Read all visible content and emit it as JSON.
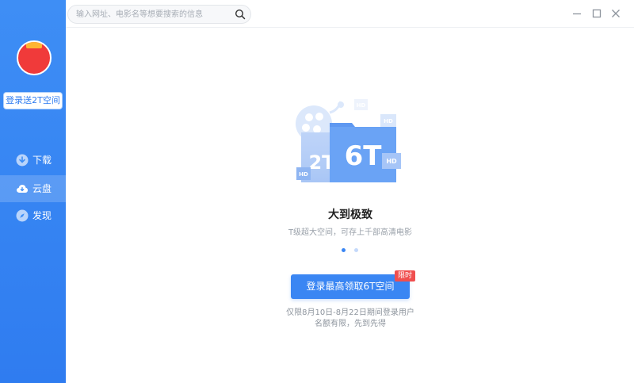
{
  "sidebar": {
    "login_label": "登录送2T空间",
    "items": [
      {
        "label": "下载",
        "icon": "download-icon",
        "active": false
      },
      {
        "label": "云盘",
        "icon": "cloud-icon",
        "active": true
      },
      {
        "label": "发现",
        "icon": "compass-icon",
        "active": false
      }
    ]
  },
  "search": {
    "placeholder": "输入网址、电影名等想要搜索的信息",
    "value": ""
  },
  "promo": {
    "card_left": "2T",
    "card_right": "6T",
    "hd": "HD",
    "title": "大到极致",
    "subtitle": "T级超大空间，可存上千部高清电影",
    "button_label": "登录最高领取6T空间",
    "badge": "限时",
    "note_line1": "仅限8月10日-8月22日期间登录用户",
    "note_line2": "名额有限，先到先得",
    "carousel_active_index": 0
  },
  "colors": {
    "accent": "#3a86f3",
    "sidebar": "#2f7cf0",
    "badge": "#f04f4f"
  }
}
